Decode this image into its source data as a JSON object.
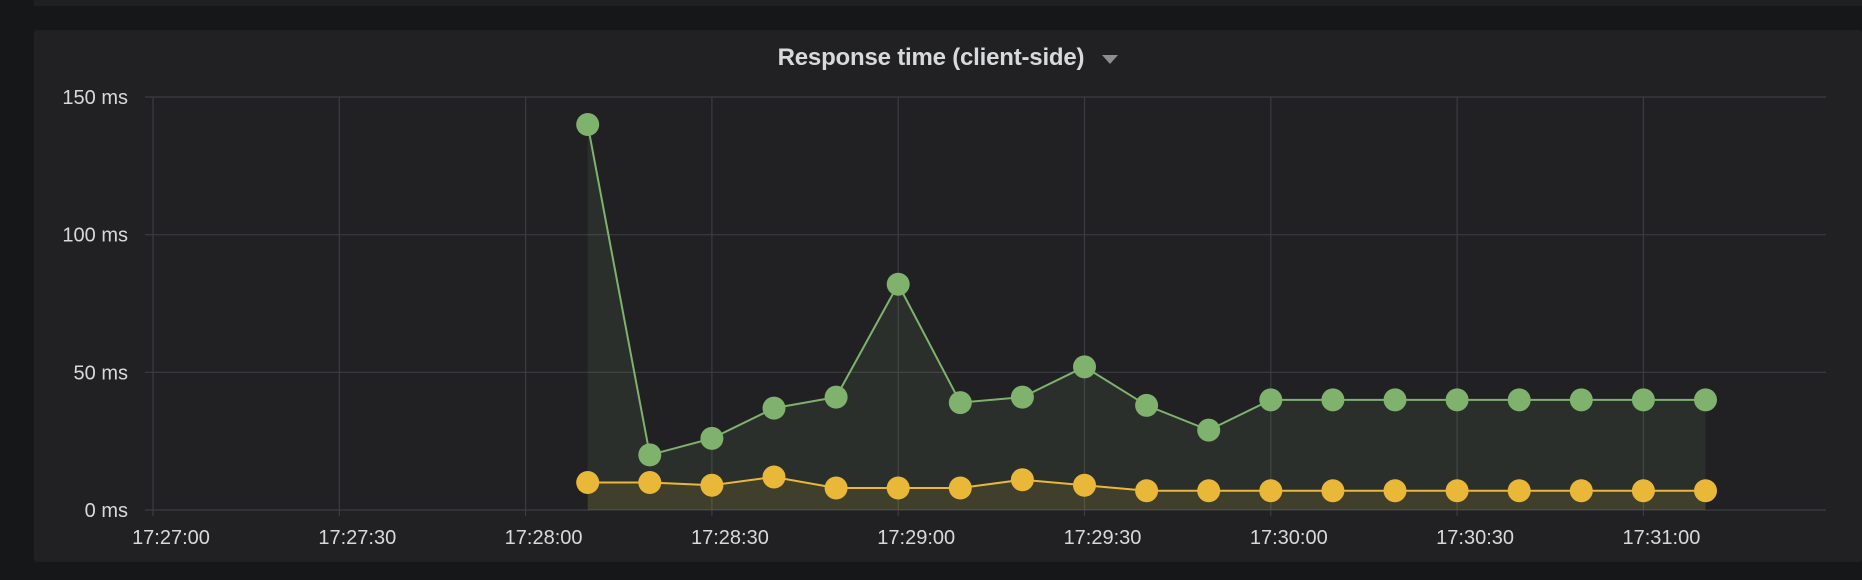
{
  "panel": {
    "title": "Response time (client-side)",
    "menu_icon": "caret-down-icon"
  },
  "colors": {
    "background": "#161719",
    "panel_background": "#212124",
    "grid": "#3b3c40",
    "text": "#d8d9da",
    "green_series": "#7eb26d",
    "yellow_series": "#eab839"
  },
  "chart_data": {
    "type": "line",
    "title": "Response time (client-side)",
    "xlabel": "",
    "ylabel": "",
    "x_ticks": [
      "17:27:00",
      "17:27:30",
      "17:28:00",
      "17:28:30",
      "17:29:00",
      "17:29:30",
      "17:30:00",
      "17:30:30",
      "17:31:00"
    ],
    "y_ticks": [
      "0 ms",
      "50 ms",
      "100 ms",
      "150 ms"
    ],
    "xlim": [
      "17:27:00",
      "17:31:30"
    ],
    "ylim": [
      0,
      150
    ],
    "grid": true,
    "legend": "none",
    "x": [
      "17:28:10",
      "17:28:20",
      "17:28:30",
      "17:28:40",
      "17:28:50",
      "17:29:00",
      "17:29:10",
      "17:29:20",
      "17:29:30",
      "17:29:40",
      "17:29:50",
      "17:30:00",
      "17:30:10",
      "17:30:20",
      "17:30:30",
      "17:30:40",
      "17:30:50",
      "17:31:00",
      "17:31:10"
    ],
    "series": [
      {
        "color": "#7eb26d",
        "fill": true,
        "values": [
          140,
          20,
          26,
          37,
          41,
          82,
          39,
          41,
          52,
          38,
          29,
          40,
          40,
          40,
          40,
          40,
          40,
          40,
          40
        ]
      },
      {
        "color": "#eab839",
        "fill": true,
        "values": [
          10,
          10,
          9,
          12,
          8,
          8,
          8,
          11,
          9,
          7,
          7,
          7,
          7,
          7,
          7,
          7,
          7,
          7,
          7
        ]
      }
    ]
  }
}
